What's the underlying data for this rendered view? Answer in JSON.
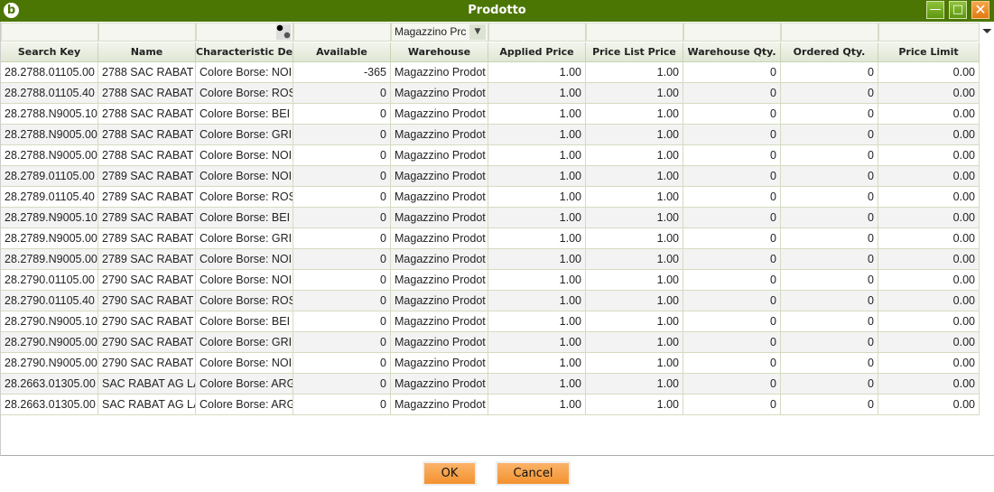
{
  "window": {
    "title": "Prodotto",
    "logo": "b"
  },
  "filter": {
    "warehouse_value": "Magazzino Prc"
  },
  "columns": [
    "Search Key",
    "Name",
    "Characteristic Des",
    "Available",
    "Warehouse",
    "Applied Price",
    "Price List Price",
    "Warehouse Qty.",
    "Ordered Qty.",
    "Price Limit"
  ],
  "rows": [
    [
      "28.2788.01105.00",
      "2788 SAC RABAT",
      "Colore Borse: NOI",
      "-365",
      "Magazzino Prodot",
      "1.00",
      "1.00",
      "0",
      "0",
      "0.00"
    ],
    [
      "28.2788.01105.40",
      "2788 SAC RABAT",
      "Colore Borse: ROS",
      "0",
      "Magazzino Prodot",
      "1.00",
      "1.00",
      "0",
      "0",
      "0.00"
    ],
    [
      "28.2788.N9005.10",
      "2788 SAC RABAT",
      "Colore Borse: BEI",
      "0",
      "Magazzino Prodot",
      "1.00",
      "1.00",
      "0",
      "0",
      "0.00"
    ],
    [
      "28.2788.N9005.00",
      "2788 SAC RABAT",
      "Colore Borse: GRI",
      "0",
      "Magazzino Prodot",
      "1.00",
      "1.00",
      "0",
      "0",
      "0.00"
    ],
    [
      "28.2788.N9005.00",
      "2788 SAC RABAT",
      "Colore Borse: NOI",
      "0",
      "Magazzino Prodot",
      "1.00",
      "1.00",
      "0",
      "0",
      "0.00"
    ],
    [
      "28.2789.01105.00",
      "2789 SAC RABAT",
      "Colore Borse: NOI",
      "0",
      "Magazzino Prodot",
      "1.00",
      "1.00",
      "0",
      "0",
      "0.00"
    ],
    [
      "28.2789.01105.40",
      "2789 SAC RABAT",
      "Colore Borse: ROS",
      "0",
      "Magazzino Prodot",
      "1.00",
      "1.00",
      "0",
      "0",
      "0.00"
    ],
    [
      "28.2789.N9005.10",
      "2789 SAC RABAT",
      "Colore Borse: BEI",
      "0",
      "Magazzino Prodot",
      "1.00",
      "1.00",
      "0",
      "0",
      "0.00"
    ],
    [
      "28.2789.N9005.00",
      "2789 SAC RABAT",
      "Colore Borse: GRI",
      "0",
      "Magazzino Prodot",
      "1.00",
      "1.00",
      "0",
      "0",
      "0.00"
    ],
    [
      "28.2789.N9005.00",
      "2789 SAC RABAT",
      "Colore Borse: NOI",
      "0",
      "Magazzino Prodot",
      "1.00",
      "1.00",
      "0",
      "0",
      "0.00"
    ],
    [
      "28.2790.01105.00",
      "2790 SAC RABAT",
      "Colore Borse: NOI",
      "0",
      "Magazzino Prodot",
      "1.00",
      "1.00",
      "0",
      "0",
      "0.00"
    ],
    [
      "28.2790.01105.40",
      "2790 SAC RABAT",
      "Colore Borse: ROS",
      "0",
      "Magazzino Prodot",
      "1.00",
      "1.00",
      "0",
      "0",
      "0.00"
    ],
    [
      "28.2790.N9005.10",
      "2790 SAC RABAT",
      "Colore Borse: BEI",
      "0",
      "Magazzino Prodot",
      "1.00",
      "1.00",
      "0",
      "0",
      "0.00"
    ],
    [
      "28.2790.N9005.00",
      "2790 SAC RABAT",
      "Colore Borse: GRI",
      "0",
      "Magazzino Prodot",
      "1.00",
      "1.00",
      "0",
      "0",
      "0.00"
    ],
    [
      "28.2790.N9005.00",
      "2790 SAC RABAT",
      "Colore Borse: NOI",
      "0",
      "Magazzino Prodot",
      "1.00",
      "1.00",
      "0",
      "0",
      "0.00"
    ],
    [
      "28.2663.01305.00",
      "SAC RABAT AG LA",
      "Colore Borse: ARG",
      "0",
      "Magazzino Prodot",
      "1.00",
      "1.00",
      "0",
      "0",
      "0.00"
    ],
    [
      "28.2663.01305.00",
      "SAC RABAT AG LA",
      "Colore Borse: ARG",
      "0",
      "Magazzino Prodot",
      "1.00",
      "1.00",
      "0",
      "0",
      "0.00"
    ]
  ],
  "buttons": {
    "ok": "OK",
    "cancel": "Cancel"
  }
}
